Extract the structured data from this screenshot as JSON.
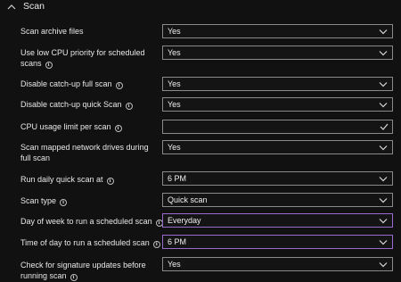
{
  "section": {
    "title": "Scan"
  },
  "settings": [
    {
      "label": "Scan archive files",
      "value": "Yes",
      "control": "select"
    },
    {
      "label": "Use low CPU priority for scheduled scans",
      "value": "Yes",
      "control": "select"
    },
    {
      "label": "Disable catch-up full scan",
      "value": "Yes",
      "control": "select"
    },
    {
      "label": "Disable catch-up quick Scan",
      "value": "Yes",
      "control": "select"
    },
    {
      "label": "CPU usage limit per scan",
      "value": "",
      "control": "input"
    },
    {
      "label": "Scan mapped network drives during full scan",
      "value": "Yes",
      "control": "select"
    },
    {
      "label": "Run daily quick scan at",
      "value": "6 PM",
      "control": "select"
    },
    {
      "label": "Scan type",
      "value": "Quick scan",
      "control": "select"
    },
    {
      "label": "Day of week to run a scheduled scan",
      "value": "Everyday",
      "control": "select",
      "active": true
    },
    {
      "label": "Time of day to run a scheduled scan",
      "value": "6 PM",
      "control": "select",
      "active": true
    },
    {
      "label": "Check for signature updates before running scan",
      "value": "Yes",
      "control": "select"
    }
  ],
  "colors": {
    "background": "#111111",
    "border": "#8a8a8a",
    "active_border": "#9a6ad0"
  },
  "icons": {
    "collapse": "chevron-up-icon",
    "dropdown": "chevron-down-icon",
    "info": "info-icon",
    "valid": "checkmark-icon"
  }
}
